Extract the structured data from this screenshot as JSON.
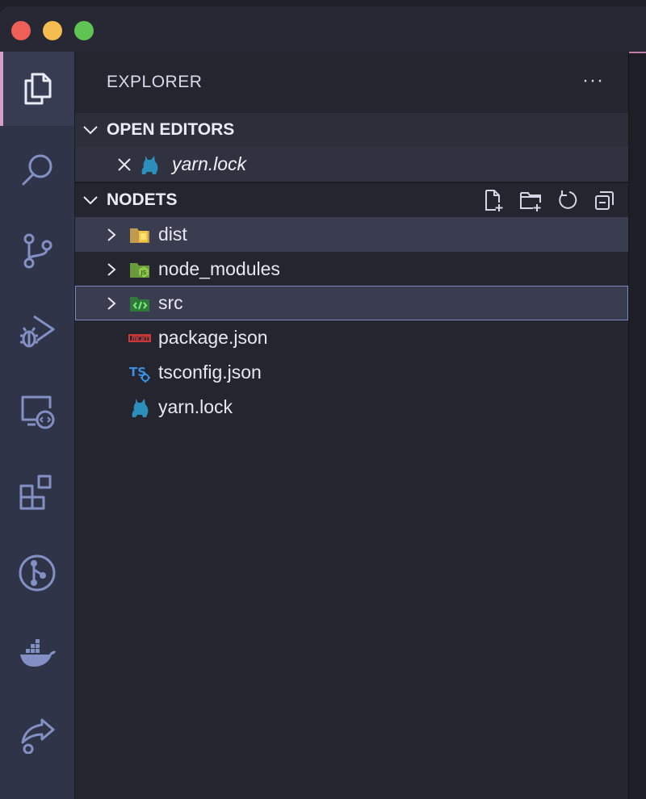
{
  "explorer": {
    "title": "EXPLORER",
    "more_label": "···"
  },
  "open_editors": {
    "title": "OPEN EDITORS",
    "items": [
      {
        "label": "yarn.lock",
        "icon": "yarn-icon"
      }
    ]
  },
  "workspace": {
    "title": "NODETS",
    "actions": [
      "new-file-icon",
      "new-folder-icon",
      "refresh-icon",
      "collapse-all-icon"
    ],
    "items": [
      {
        "label": "dist",
        "type": "folder",
        "icon": "dist-folder-icon"
      },
      {
        "label": "node_modules",
        "type": "folder",
        "icon": "node-modules-folder-icon"
      },
      {
        "label": "src",
        "type": "folder",
        "icon": "src-folder-icon"
      },
      {
        "label": "package.json",
        "type": "file",
        "icon": "npm-icon"
      },
      {
        "label": "tsconfig.json",
        "type": "file",
        "icon": "tsconfig-icon"
      },
      {
        "label": "yarn.lock",
        "type": "file",
        "icon": "yarn-icon"
      }
    ]
  },
  "activity_bar": [
    "explorer-icon",
    "search-icon",
    "source-control-icon",
    "run-debug-icon",
    "remote-explorer-icon",
    "extensions-icon",
    "git-graph-icon",
    "docker-icon",
    "live-share-icon"
  ],
  "colors": {
    "activity_bar_bg": "#303448",
    "sidebar_bg": "#24252f",
    "accent": "#d3a0c8",
    "focus_border": "#7b86c2",
    "icon_muted": "#8390c4"
  }
}
